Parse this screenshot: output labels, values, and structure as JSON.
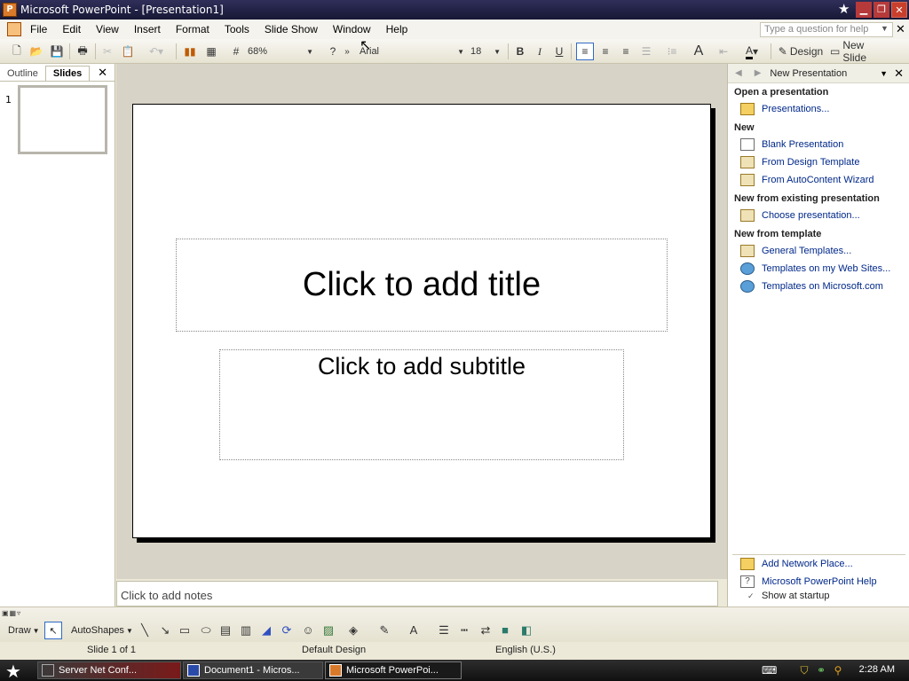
{
  "window": {
    "title": "Microsoft PowerPoint - [Presentation1]",
    "icons": [
      "star-icon",
      "minimize-icon",
      "maximize-icon",
      "close-icon"
    ]
  },
  "menubar": {
    "items": [
      "File",
      "Edit",
      "View",
      "Insert",
      "Format",
      "Tools",
      "Slide Show",
      "Window",
      "Help"
    ],
    "help_placeholder": "Type a question for help"
  },
  "toolbar": {
    "zoom": "68%",
    "font": "Arial",
    "font_size": "18",
    "bold": "B",
    "italic": "I",
    "underline": "U",
    "design": "Design",
    "new_slide": "New Slide"
  },
  "left_pane": {
    "tabs": [
      "Outline",
      "Slides"
    ],
    "selected_tab": "Slides",
    "slide_number": "1"
  },
  "slide": {
    "title_placeholder": "Click to add title",
    "subtitle_placeholder": "Click to add subtitle"
  },
  "notes": {
    "placeholder": "Click to add notes"
  },
  "task_pane": {
    "title": "New Presentation",
    "sections": {
      "open": "Open a presentation",
      "new": "New",
      "existing": "New from existing presentation",
      "template": "New from template"
    },
    "links": {
      "presentations": "Presentations...",
      "blank": "Blank Presentation",
      "design_template": "From Design Template",
      "autocontent": "From AutoContent Wizard",
      "choose": "Choose presentation...",
      "general": "General Templates...",
      "web_sites": "Templates on my Web Sites...",
      "microsoft": "Templates on Microsoft.com",
      "network": "Add Network Place...",
      "help": "Microsoft PowerPoint Help"
    },
    "show_at_startup": "Show at startup",
    "show_at_startup_checked": true
  },
  "drawbar": {
    "draw": "Draw",
    "autoshapes": "AutoShapes"
  },
  "statusbar": {
    "slide": "Slide 1 of 1",
    "design": "Default Design",
    "language": "English (U.S.)"
  },
  "taskbar": {
    "tasks": [
      "Server Net Conf...",
      "Document1 - Micros...",
      "Microsoft PowerPoi..."
    ],
    "clock": "2:28 AM"
  }
}
